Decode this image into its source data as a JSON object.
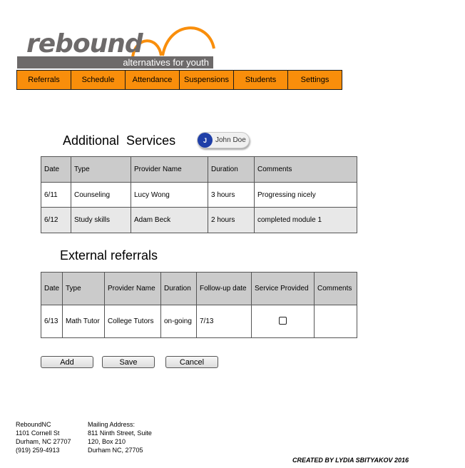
{
  "logo": {
    "word": "rebound",
    "tagline": "alternatives for youth",
    "accent_color": "#f98e0b"
  },
  "nav": [
    "Referrals",
    "Schedule",
    "Attendance",
    "Suspensions",
    "Students",
    "Settings"
  ],
  "additional_services": {
    "title": "Additional  Services",
    "user": {
      "initial": "J",
      "name": "John Doe"
    },
    "columns": [
      "Date",
      "Type",
      "Provider Name",
      "Duration",
      "Comments"
    ],
    "rows": [
      [
        "6/11",
        "Counseling",
        "Lucy Wong",
        "3 hours",
        "Progressing nicely"
      ],
      [
        "6/12",
        "Study skills",
        "Adam Beck",
        "2 hours",
        "completed module 1"
      ]
    ]
  },
  "external_referrals": {
    "title": "External referrals",
    "columns": [
      "Date",
      "Type",
      "Provider Name",
      "Duration",
      "Follow-up date",
      "Service Provided",
      "Comments"
    ],
    "rows": [
      {
        "date": "6/13",
        "type": "Math Tutor",
        "provider": "College Tutors",
        "duration": "on-going",
        "followup": "7/13",
        "service_provided": false,
        "comments": ""
      }
    ]
  },
  "buttons": {
    "add": "Add",
    "save": "Save",
    "cancel": "Cancel"
  },
  "footer": {
    "org": [
      "ReboundNC",
      "1101 Cornell St",
      "Durham, NC 27707",
      "(919) 259-4913"
    ],
    "mailing": [
      "Mailing Address:",
      "811 Ninth Street, Suite",
      "120, Box 210",
      "Durham NC, 27705"
    ],
    "credit": "CREATED BY LYDIA SBITYAKOV 2016"
  }
}
